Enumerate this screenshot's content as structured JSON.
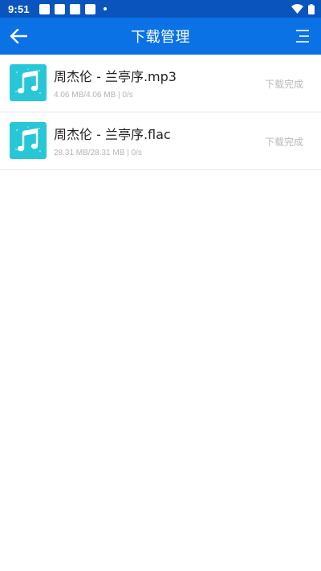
{
  "status_bar": {
    "time": "9:51",
    "icons": [
      "notification-square",
      "notification-square",
      "notification-square",
      "notification-square",
      "notification-dot",
      "wifi-icon",
      "battery-icon"
    ]
  },
  "app_bar": {
    "title": "下载管理",
    "back_icon": "arrow-left-icon",
    "menu_icon": "menu-icon",
    "background": "#0b72e6"
  },
  "downloads": [
    {
      "name": "周杰伦 - 兰亭序.mp3",
      "meta": "4.06 MB/4.06 MB | 0/s",
      "status": "下载完成",
      "icon": "music-note-icon"
    },
    {
      "name": "周杰伦 - 兰亭序.flac",
      "meta": "28.31 MB/28.31 MB | 0/s",
      "status": "下载完成",
      "icon": "music-note-icon"
    }
  ],
  "colors": {
    "status_bar": "#0a55bd",
    "icon_bg": "#27c7d8"
  }
}
